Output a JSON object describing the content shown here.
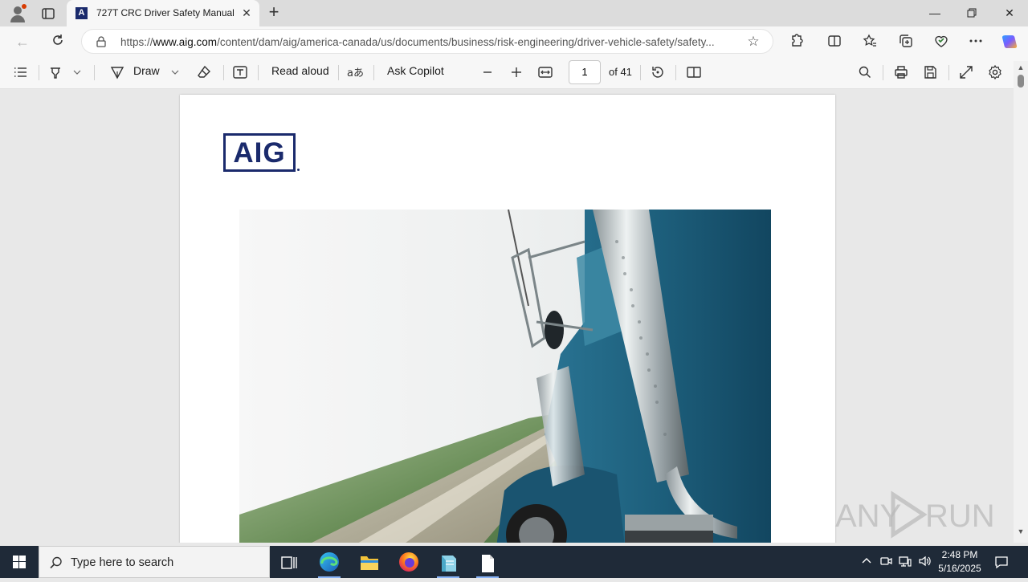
{
  "browser": {
    "tab_title": "727T CRC Driver Safety Manual 2(",
    "tab_favicon_letter": "A",
    "url_prefix": "https://",
    "url_host": "www.aig.com",
    "url_path": "/content/dam/aig/america-canada/us/documents/business/risk-engineering/driver-vehicle-safety/safety..."
  },
  "pdf_toolbar": {
    "draw_label": "Draw",
    "read_aloud_label": "Read aloud",
    "ask_copilot_label": "Ask Copilot",
    "page_number": "1",
    "page_total": "of 41"
  },
  "document": {
    "logo_text": "AIG"
  },
  "watermark": {
    "text_left": "ANY",
    "text_right": "RUN"
  },
  "taskbar": {
    "search_placeholder": "Type here to search",
    "time": "2:48 PM",
    "date": "5/16/2025"
  },
  "colors": {
    "brand_navy": "#1a2a6c",
    "taskbar_bg": "#1f2a38",
    "truck_blue": "#1d5f7c"
  }
}
